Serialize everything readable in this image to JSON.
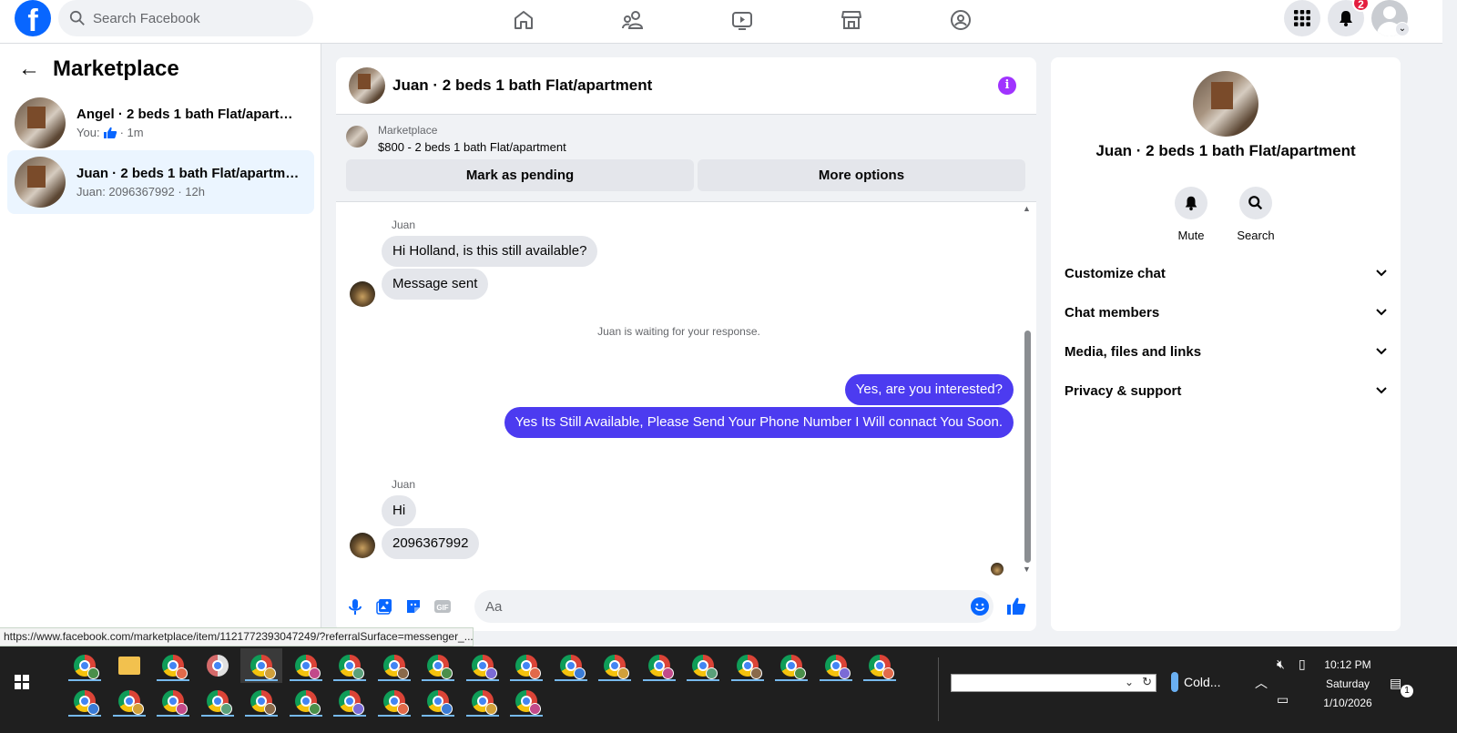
{
  "topbar": {
    "logo_letter": "f",
    "search_placeholder": "Search Facebook",
    "notification_count": "2",
    "nav_items": [
      "home-icon",
      "friends-icon",
      "video-icon",
      "marketplace-icon",
      "groups-icon"
    ]
  },
  "left_panel": {
    "title": "Marketplace",
    "conversations": [
      {
        "title": "Angel · 2 beds 1 bath Flat/apartme...",
        "sub_prefix": "You:",
        "sub_suffix": "· 1m",
        "has_like": true
      },
      {
        "title": "Juan · 2 beds 1 bath Flat/apartment",
        "sub": "Juan: 2096367992 · 12h",
        "active": true
      }
    ]
  },
  "chat": {
    "title": "Juan · 2 beds 1 bath Flat/apartment",
    "listing_label": "Marketplace",
    "listing_price": "$800 - 2 beds 1 bath Flat/apartment",
    "mark_pending": "Mark as pending",
    "more_options": "More options",
    "messages": {
      "sender1": "Juan",
      "m1": "Hi Holland, is this still available?",
      "m2": "Message sent",
      "system": "Juan is waiting for your response.",
      "out1": "Yes, are you interested?",
      "out2": "Yes Its Still Available, Please Send Your Phone Number I Will connact You Soon.",
      "sender2": "Juan",
      "m3": "Hi",
      "m4": "2096367992"
    },
    "composer_placeholder": "Aa",
    "gif_label": "GIF"
  },
  "info_panel": {
    "name": "Juan · 2 beds 1 bath Flat/apartment",
    "mute": "Mute",
    "search": "Search",
    "sections": [
      "Customize chat",
      "Chat members",
      "Media, files and links",
      "Privacy & support"
    ]
  },
  "status_url": "https://www.facebook.com/marketplace/item/1121772393047249/?referralSurface=messenger_...",
  "taskbar": {
    "weather": "Cold...",
    "time": "10:12 PM",
    "day": "Saturday",
    "date": "1/10/2026",
    "notification_count": "1",
    "apps": [
      "chrome",
      "file-explorer",
      "chrome",
      "snipping-tool",
      "chrome",
      "chrome",
      "chrome",
      "chrome",
      "chrome",
      "chrome",
      "chrome",
      "chrome",
      "chrome",
      "chrome",
      "chrome",
      "chrome",
      "chrome",
      "chrome",
      "chrome",
      "chrome",
      "chrome",
      "chrome",
      "chrome",
      "chrome",
      "chrome",
      "chrome",
      "chrome",
      "chrome",
      "chrome",
      "chrome"
    ],
    "colors": {
      "accent": "#76b9ed",
      "background": "#1f1f1f"
    }
  },
  "colors": {
    "brand": "#0866ff",
    "outgoing_bubble": "#4c3bf0",
    "incoming_bubble": "#e4e6eb",
    "info_icon": "#a033ff"
  }
}
